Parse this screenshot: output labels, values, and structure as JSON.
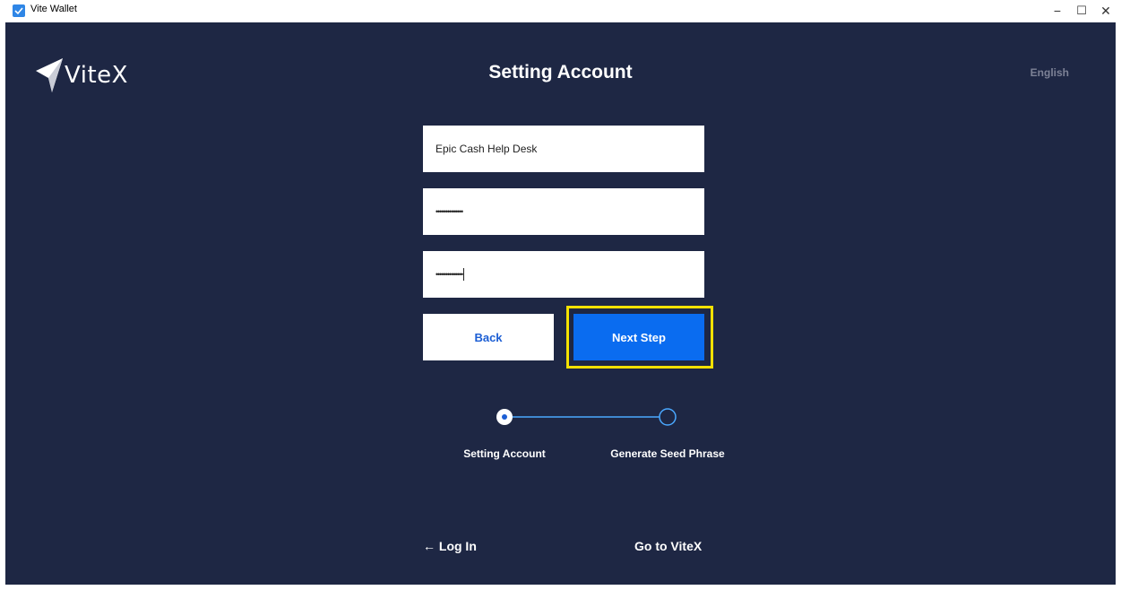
{
  "window": {
    "title": "Vite Wallet",
    "controls": [
      "−",
      "☐",
      "✕"
    ]
  },
  "header": {
    "logo_text": "ViteX",
    "title": "Setting Account",
    "language": "English"
  },
  "form": {
    "account_name": "Epic Cash Help Desk",
    "password_masked": "••••••••••••••",
    "confirm_password_masked": "••••••••••••••"
  },
  "buttons": {
    "back": "Back",
    "next": "Next Step"
  },
  "steps": [
    {
      "label": "Setting Account",
      "active": true
    },
    {
      "label": "Generate Seed Phrase",
      "active": false
    }
  ],
  "footer": {
    "login": "← Log In",
    "go_vitex": "Go to ViteX"
  },
  "colors": {
    "background": "#1e2744",
    "accent": "#0a6cf0",
    "highlight": "#f4e100",
    "step_line": "#4aa8ff"
  }
}
